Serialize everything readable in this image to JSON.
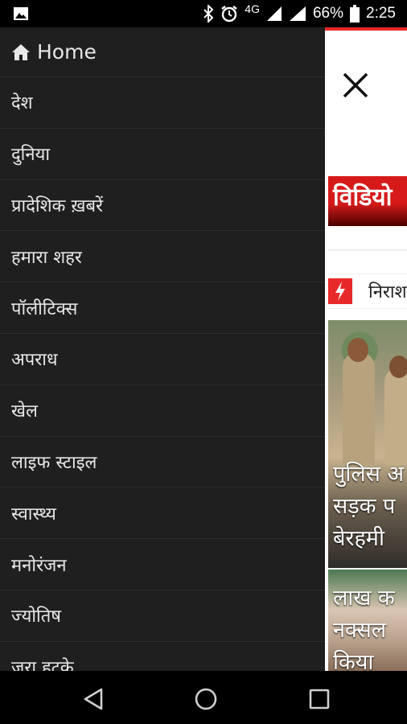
{
  "status_bar": {
    "network": "4G",
    "battery": "66%",
    "time": "2:25",
    "icons": [
      "image-icon",
      "bluetooth-icon",
      "alarm-icon",
      "signal-icon",
      "wifi-icon",
      "battery-icon"
    ]
  },
  "drawer": {
    "home_label": "Home",
    "items": [
      {
        "label": "देश"
      },
      {
        "label": "दुनिया"
      },
      {
        "label": "प्रादेशिक ख़बरें"
      },
      {
        "label": "हमारा शहर"
      },
      {
        "label": "पॉलीटिक्स"
      },
      {
        "label": "अपराध"
      },
      {
        "label": "खेल"
      },
      {
        "label": "लाइफ स्टाइल"
      },
      {
        "label": "स्वास्थ्य"
      },
      {
        "label": "मनोरंजन"
      },
      {
        "label": "ज्योतिष"
      },
      {
        "label": "जरा हटके"
      }
    ]
  },
  "page": {
    "banner": "विडियो",
    "breaking_text": "निराश",
    "story1_lines": [
      "पुलिस अ",
      "सड़क प",
      "बेरहमी"
    ],
    "story2_lines": [
      "लाख क",
      "नक्सल",
      "किया"
    ]
  },
  "colors": {
    "drawer_bg": "#1f1f1f",
    "accent_red": "#e8292a"
  }
}
